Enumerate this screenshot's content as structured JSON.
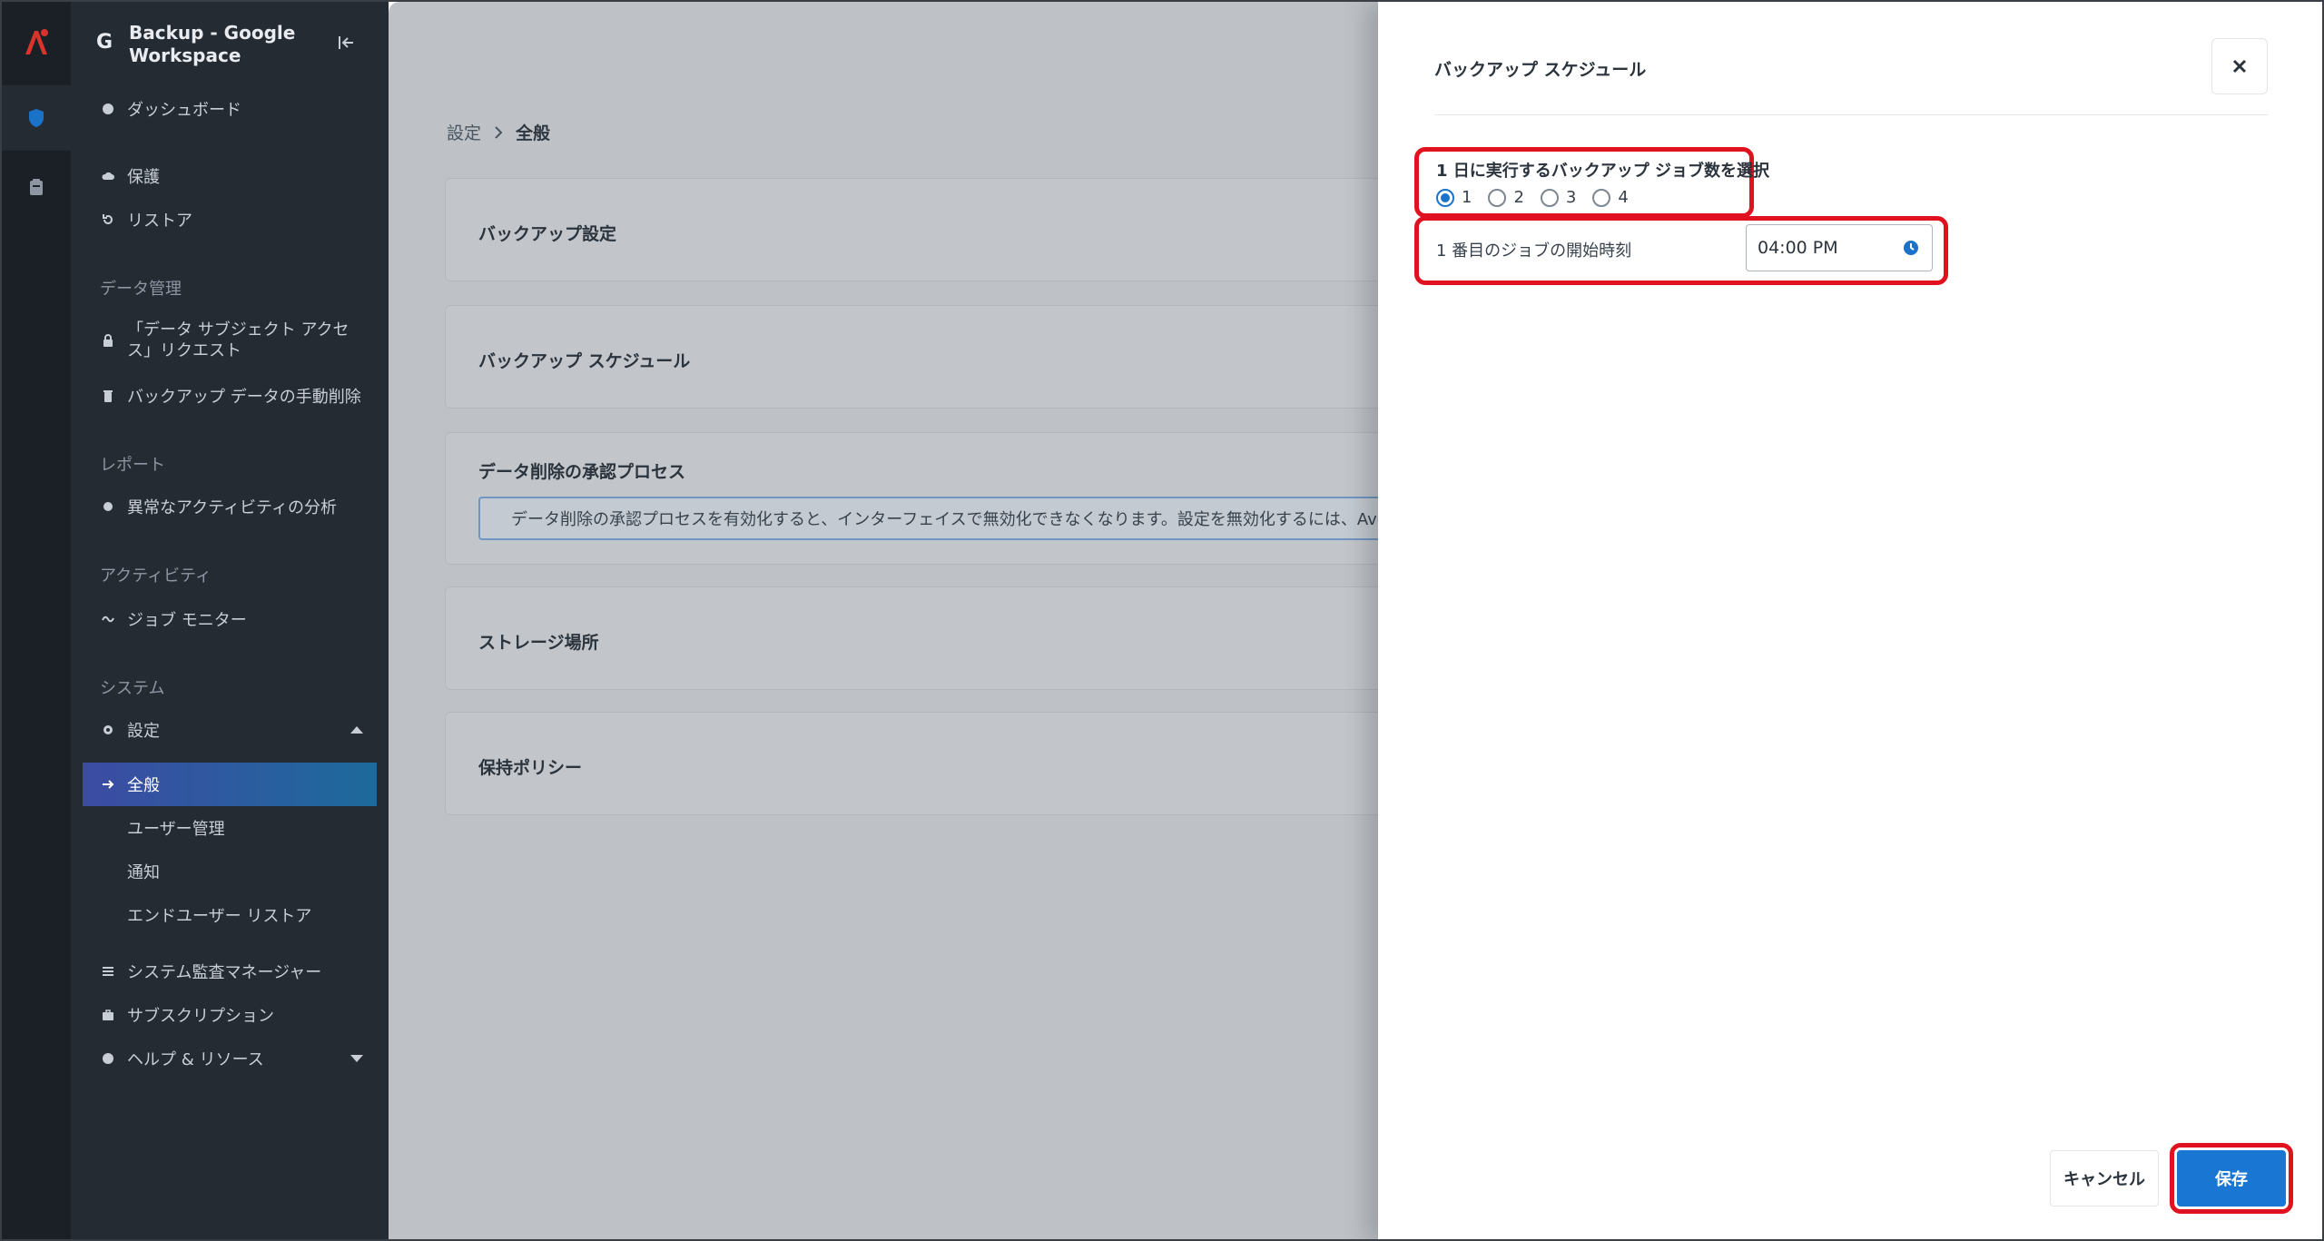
{
  "app": {
    "title": "Backup - Google Workspace",
    "g_letter": "G"
  },
  "sidebar": {
    "items": {
      "dashboard": "ダッシュボード",
      "protect": "保護",
      "restore": "リストア",
      "section_data": "データ管理",
      "dsar": "「データ サブジェクト アクセス」リクエスト",
      "manual_delete": "バックアップ データの手動削除",
      "section_report": "レポート",
      "anomaly": "異常なアクティビティの分析",
      "section_activity": "アクティビティ",
      "job_monitor": "ジョブ モニター",
      "section_system": "システム",
      "settings": "設定",
      "general": "全般",
      "user_mgmt": "ユーザー管理",
      "notify": "通知",
      "enduser_restore": "エンドユーザー リストア",
      "audit": "システム監査マネージャー",
      "subscription": "サブスクリプション",
      "help": "ヘルプ & リソース"
    }
  },
  "breadcrumb": {
    "parent": "設定",
    "current": "全般"
  },
  "cards": {
    "backup_settings": "バックアップ設定",
    "backup_schedule": "バックアップ スケジュール",
    "approval": "データ削除の承認プロセス",
    "approval_info": "データ削除の承認プロセスを有効化すると、インターフェイスで無効化できなくなります。設定を無効化するには、AvePoint 技術サ",
    "storage": "ストレージ場所",
    "retention": "保持ポリシー"
  },
  "panel": {
    "title": "バックアップ スケジュール",
    "question": "1 日に実行するバックアップ ジョブ数を選択",
    "options": [
      "1",
      "2",
      "3",
      "4"
    ],
    "selected": "1",
    "job_label": "1 番目のジョブの開始時刻",
    "time_value": "04:00 PM",
    "cancel": "キャンセル",
    "save": "保存"
  },
  "colors": {
    "accent": "#1976d2",
    "highlight": "#e0121f",
    "logo": "#d9342b",
    "shield": "#1a73c8"
  }
}
